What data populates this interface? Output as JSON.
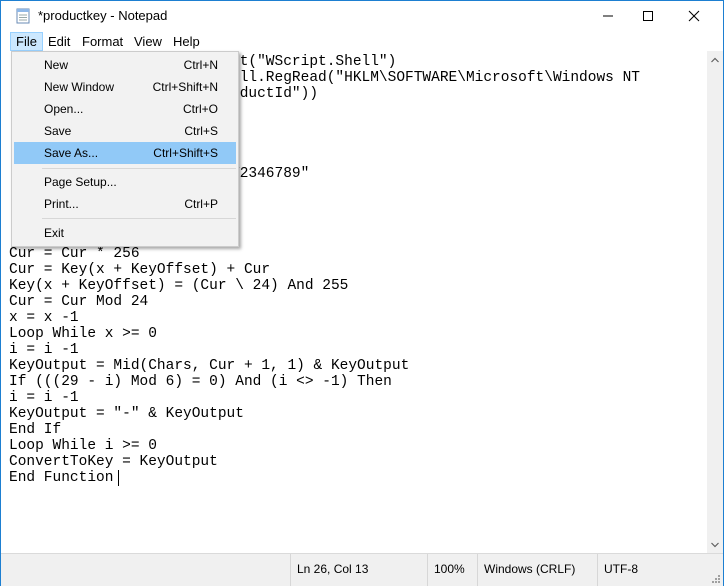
{
  "window": {
    "title": "*productkey - Notepad",
    "controls": {
      "minimize": "minimize",
      "maximize": "maximize",
      "close": "close"
    }
  },
  "menubar": {
    "items": [
      {
        "label": "File",
        "active": true
      },
      {
        "label": "Edit",
        "active": false
      },
      {
        "label": "Format",
        "active": false
      },
      {
        "label": "View",
        "active": false
      },
      {
        "label": "Help",
        "active": false
      }
    ]
  },
  "file_menu": {
    "items": [
      {
        "label": "New",
        "shortcut": "Ctrl+N"
      },
      {
        "label": "New Window",
        "shortcut": "Ctrl+Shift+N"
      },
      {
        "label": "Open...",
        "shortcut": "Ctrl+O"
      },
      {
        "label": "Save",
        "shortcut": "Ctrl+S"
      },
      {
        "label": "Save As...",
        "shortcut": "Ctrl+Shift+S",
        "highlighted": true
      },
      {
        "label": "Page Setup...",
        "shortcut": ""
      },
      {
        "label": "Print...",
        "shortcut": "Ctrl+P"
      },
      {
        "label": "Exit",
        "shortcut": ""
      }
    ]
  },
  "editor": {
    "partial_lines": [
      "ct(\"WScript.Shell\")",
      "ell.RegRead(\"HKLM\\SOFTWARE\\Microsoft\\Windows NT",
      "oductId\"))",
      ")",
      "Y2346789\""
    ],
    "lines": [
      "Cur = Cur * 256",
      "Cur = Key(x + KeyOffset) + Cur",
      "Key(x + KeyOffset) = (Cur \\ 24) And 255",
      "Cur = Cur Mod 24",
      "x = x -1",
      "Loop While x >= 0",
      "i = i -1",
      "KeyOutput = Mid(Chars, Cur + 1, 1) & KeyOutput",
      "If (((29 - i) Mod 6) = 0) And (i <> -1) Then",
      "i = i -1",
      "KeyOutput = \"-\" & KeyOutput",
      "End If",
      "Loop While i >= 0",
      "ConvertToKey = KeyOutput",
      "End Function"
    ]
  },
  "statusbar": {
    "position": "Ln 26, Col 13",
    "zoom": "100%",
    "line_ending": "Windows (CRLF)",
    "encoding": "UTF-8"
  },
  "colors": {
    "accent": "#0a78c8",
    "menu_highlight": "#91c9f7",
    "menu_active": "#cce8ff"
  }
}
